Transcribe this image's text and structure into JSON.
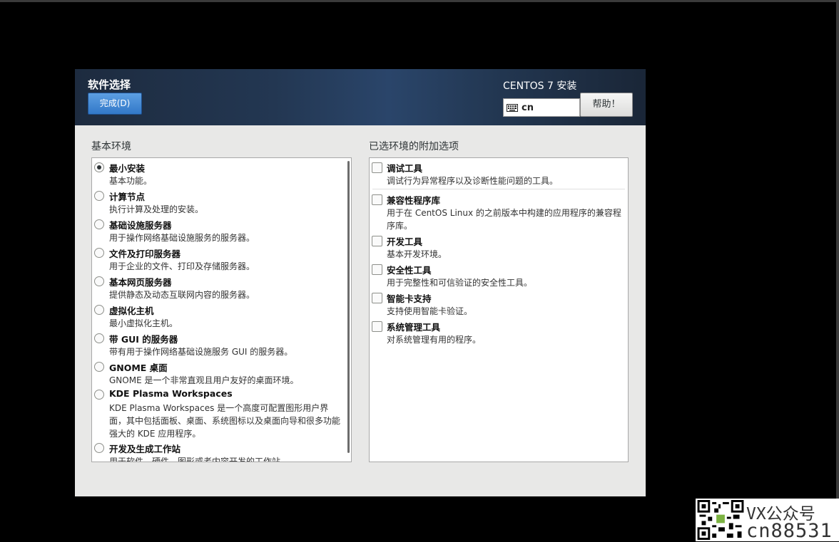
{
  "header": {
    "title": "软件选择",
    "done_label": "完成(D)",
    "product": "CENTOS 7 安装",
    "keyboard_layout": "cn",
    "help_label": "帮助！"
  },
  "base_env": {
    "title": "基本环境",
    "selected": "最小安装",
    "items": [
      {
        "name": "最小安装",
        "desc": "基本功能。"
      },
      {
        "name": "计算节点",
        "desc": "执行计算及处理的安装。"
      },
      {
        "name": "基础设施服务器",
        "desc": "用于操作网络基础设施服务的服务器。"
      },
      {
        "name": "文件及打印服务器",
        "desc": "用于企业的文件、打印及存储服务器。"
      },
      {
        "name": "基本网页服务器",
        "desc": "提供静态及动态互联网内容的服务器。"
      },
      {
        "name": "虚拟化主机",
        "desc": "最小虚拟化主机。"
      },
      {
        "name": "带 GUI 的服务器",
        "desc": "带有用于操作网络基础设施服务 GUI 的服务器。"
      },
      {
        "name": "GNOME 桌面",
        "desc": "GNOME 是一个非常直观且用户友好的桌面环境。"
      },
      {
        "name": "KDE Plasma Workspaces",
        "desc": "KDE Plasma Workspaces 是一个高度可配置图形用户界面，其中包括面板、桌面、系统图标以及桌面向导和很多功能强大的 KDE 应用程序。"
      },
      {
        "name": "开发及生成工作站",
        "desc": "用于软件、硬件、图形或者内容开发的工作站。"
      }
    ]
  },
  "addons": {
    "title": "已选环境的附加选项",
    "items": [
      {
        "name": "调试工具",
        "desc": "调试行为异常程序以及诊断性能问题的工具。"
      },
      {
        "name": "兼容性程序库",
        "desc": "用于在 CentOS Linux 的之前版本中构建的应用程序的兼容程序库。"
      },
      {
        "name": "开发工具",
        "desc": "基本开发环境。"
      },
      {
        "name": "安全性工具",
        "desc": "用于完整性和可信验证的安全性工具。"
      },
      {
        "name": "智能卡支持",
        "desc": "支持使用智能卡验证。"
      },
      {
        "name": "系统管理工具",
        "desc": "对系统管理有用的程序。"
      }
    ]
  },
  "watermark": {
    "line1": "VX公众号",
    "line2": "cn88531"
  }
}
